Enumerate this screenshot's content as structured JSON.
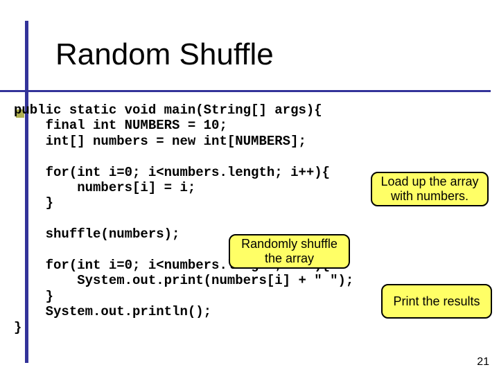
{
  "title": "Random Shuffle",
  "code": {
    "l1": "public static void main(String[] args){",
    "l2": "    final int NUMBERS = 10;",
    "l3": "    int[] numbers = new int[NUMBERS];",
    "l4": "",
    "l5": "    for(int i=0; i<numbers.length; i++){",
    "l6": "        numbers[i] = i;",
    "l7": "    }",
    "l8": "",
    "l9": "    shuffle(numbers);",
    "l10": "",
    "l11": "    for(int i=0; i<numbers.length; i++){",
    "l12": "        System.out.print(numbers[i] + \" \");",
    "l13": "    }",
    "l14": "    System.out.println();",
    "l15": "}"
  },
  "callouts": {
    "load": "Load up the array\nwith numbers.",
    "shuffle": "Randomly shuffle\nthe array",
    "print": "Print the results"
  },
  "page_number": "21"
}
